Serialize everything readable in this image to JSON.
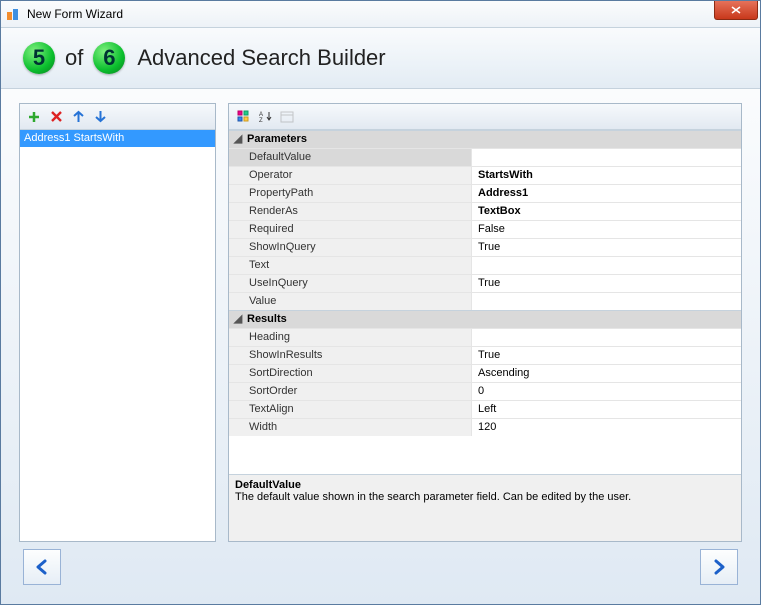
{
  "window": {
    "title": "New Form Wizard"
  },
  "header": {
    "step_current": "5",
    "of_label": "of",
    "step_total": "6",
    "title": "Advanced Search Builder"
  },
  "left": {
    "items": [
      "Address1 StartsWith"
    ]
  },
  "grid": {
    "sections": [
      {
        "name": "Parameters",
        "rows": [
          {
            "name": "DefaultValue",
            "value": ""
          },
          {
            "name": "Operator",
            "value": "StartsWith",
            "bold": true
          },
          {
            "name": "PropertyPath",
            "value": "Address1",
            "bold": true
          },
          {
            "name": "RenderAs",
            "value": "TextBox",
            "bold": true
          },
          {
            "name": "Required",
            "value": "False"
          },
          {
            "name": "ShowInQuery",
            "value": "True"
          },
          {
            "name": "Text",
            "value": ""
          },
          {
            "name": "UseInQuery",
            "value": "True"
          },
          {
            "name": "Value",
            "value": ""
          }
        ]
      },
      {
        "name": "Results",
        "rows": [
          {
            "name": "Heading",
            "value": ""
          },
          {
            "name": "ShowInResults",
            "value": "True"
          },
          {
            "name": "SortDirection",
            "value": "Ascending"
          },
          {
            "name": "SortOrder",
            "value": "0"
          },
          {
            "name": "TextAlign",
            "value": "Left"
          },
          {
            "name": "Width",
            "value": "120"
          }
        ]
      }
    ],
    "description": {
      "title": "DefaultValue",
      "text": "The default value shown in the search parameter field. Can be edited by the user."
    }
  }
}
